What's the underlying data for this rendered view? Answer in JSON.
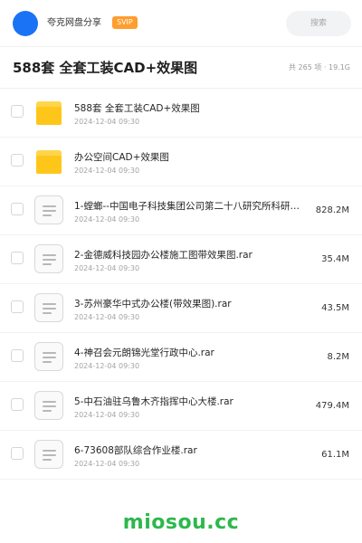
{
  "header": {
    "user_name": "夸克网盘分享",
    "badge": "SVIP",
    "search_placeholder": "搜索"
  },
  "title_bar": {
    "title": "588套 全套工装CAD+效果图",
    "summary": "共 265 项 · 19.1G"
  },
  "files": [
    {
      "type": "folder",
      "name": "588套 全套工装CAD+效果图",
      "date": "2024-12-04 09:30",
      "size": ""
    },
    {
      "type": "folder",
      "name": "办公空间CAD+效果图",
      "date": "2024-12-04 09:30",
      "size": ""
    },
    {
      "type": "file",
      "name": "1-螳螂--中国电子科技集团公司第二十八研究所科研…",
      "date": "2024-12-04 09:30",
      "size": "828.2M"
    },
    {
      "type": "file",
      "name": "2-金德威科技园办公楼施工图带效果图.rar",
      "date": "2024-12-04 09:30",
      "size": "35.4M"
    },
    {
      "type": "file",
      "name": "3-苏州豪华中式办公楼(带效果图).rar",
      "date": "2024-12-04 09:30",
      "size": "43.5M"
    },
    {
      "type": "file",
      "name": "4-神召会元朗锦光堂行政中心.rar",
      "date": "2024-12-04 09:30",
      "size": "8.2M"
    },
    {
      "type": "file",
      "name": "5-中石油驻乌鲁木齐指挥中心大楼.rar",
      "date": "2024-12-04 09:30",
      "size": "479.4M"
    },
    {
      "type": "file",
      "name": "6-73608部队综合作业楼.rar",
      "date": "2024-12-04 09:30",
      "size": "61.1M"
    }
  ],
  "watermark": "miosou.cc",
  "colors": {
    "avatar": "#1a73f5",
    "badge": "#ff9d2e",
    "folder": "#ffc61a",
    "watermark": "#2db84d"
  },
  "icons": {
    "folder": "folder-icon",
    "file": "rar-file-icon"
  }
}
